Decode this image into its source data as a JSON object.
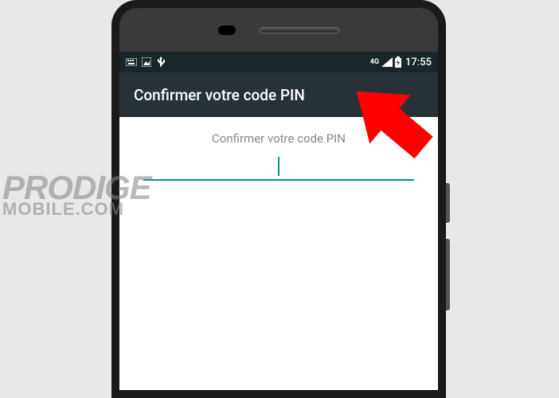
{
  "status_bar": {
    "network_label": "4G",
    "time": "17:55"
  },
  "app_bar": {
    "title": "Confirmer votre code PIN"
  },
  "content": {
    "hint": "Confirmer votre code PIN",
    "pin_value": ""
  },
  "watermark": {
    "line1": "PRODIGE",
    "line2": "MOBILE.COM"
  },
  "colors": {
    "accent": "#009688",
    "arrow": "#ff0000"
  }
}
